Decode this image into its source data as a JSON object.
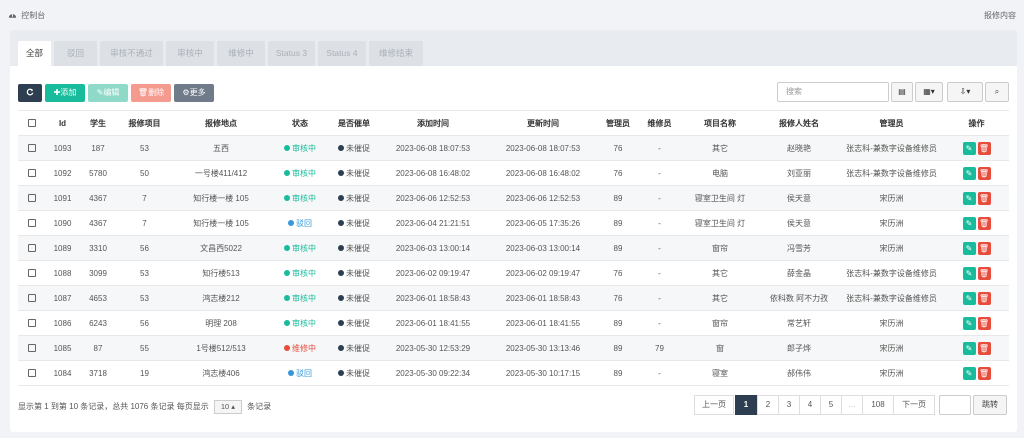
{
  "breadcrumb": "控制台",
  "page_title": "报修内容",
  "tabs": [
    {
      "label": "全部"
    },
    {
      "label": "驳回"
    },
    {
      "label": "审核不通过"
    },
    {
      "label": "审核中"
    },
    {
      "label": "维修中"
    },
    {
      "label": "Status 3"
    },
    {
      "label": "Status 4"
    },
    {
      "label": "维修结束"
    }
  ],
  "toolbar": {
    "add": "添加",
    "edit": "编辑",
    "delete": "删除",
    "more": "更多"
  },
  "search": {
    "placeholder": "搜索"
  },
  "columns": [
    "Id",
    "学生",
    "报修项目",
    "报修地点",
    "状态",
    "是否催单",
    "添加时间",
    "更新时间",
    "管理员",
    "维修员",
    "项目名称",
    "报修人姓名",
    "管理员",
    "操作"
  ],
  "status_colors": {
    "审核中": "#18bc9c",
    "驳回": "#3498db",
    "维修中": "#e74c3c",
    "未催促": "#2c3e50"
  },
  "rows": [
    {
      "id": "1093",
      "student": "187",
      "item": "53",
      "location": "五西",
      "status": "审核中",
      "urge": "未催促",
      "created": "2023-06-08 18:07:53",
      "updated": "2023-06-08 18:07:53",
      "admin": "76",
      "worker": "-",
      "project": "其它",
      "reporter": "赵晓艳",
      "admin_name": "张志科-兼数字设备维修员"
    },
    {
      "id": "1092",
      "student": "5780",
      "item": "50",
      "location": "一号楼411/412",
      "status": "审核中",
      "urge": "未催促",
      "created": "2023-06-08 16:48:02",
      "updated": "2023-06-08 16:48:02",
      "admin": "76",
      "worker": "-",
      "project": "电脑",
      "reporter": "刘亚丽",
      "admin_name": "张志科-兼数字设备维修员"
    },
    {
      "id": "1091",
      "student": "4367",
      "item": "7",
      "location": "知行楼一楼 105",
      "status": "审核中",
      "urge": "未催促",
      "created": "2023-06-06 12:52:53",
      "updated": "2023-06-06 12:52:53",
      "admin": "89",
      "worker": "-",
      "project": "寝室卫生间 灯",
      "reporter": "侯天意",
      "admin_name": "宋历洲"
    },
    {
      "id": "1090",
      "student": "4367",
      "item": "7",
      "location": "知行楼一楼 105",
      "status": "驳回",
      "urge": "未催促",
      "created": "2023-06-04 21:21:51",
      "updated": "2023-06-05 17:35:26",
      "admin": "89",
      "worker": "-",
      "project": "寝室卫生间 灯",
      "reporter": "侯天意",
      "admin_name": "宋历洲"
    },
    {
      "id": "1089",
      "student": "3310",
      "item": "56",
      "location": "文昌西5022",
      "status": "审核中",
      "urge": "未催促",
      "created": "2023-06-03 13:00:14",
      "updated": "2023-06-03 13:00:14",
      "admin": "89",
      "worker": "-",
      "project": "窗帘",
      "reporter": "冯雪芳",
      "admin_name": "宋历洲"
    },
    {
      "id": "1088",
      "student": "3099",
      "item": "53",
      "location": "知行楼513",
      "status": "审核中",
      "urge": "未催促",
      "created": "2023-06-02 09:19:47",
      "updated": "2023-06-02 09:19:47",
      "admin": "76",
      "worker": "-",
      "project": "其它",
      "reporter": "薛金晶",
      "admin_name": "张志科-兼数字设备维修员"
    },
    {
      "id": "1087",
      "student": "4653",
      "item": "53",
      "location": "鸿志楼212",
      "status": "审核中",
      "urge": "未催促",
      "created": "2023-06-01 18:58:43",
      "updated": "2023-06-01 18:58:43",
      "admin": "76",
      "worker": "-",
      "project": "其它",
      "reporter": "依科数 阿不力孜",
      "admin_name": "张志科-兼数字设备维修员"
    },
    {
      "id": "1086",
      "student": "6243",
      "item": "56",
      "location": "明理 208",
      "status": "审核中",
      "urge": "未催促",
      "created": "2023-06-01 18:41:55",
      "updated": "2023-06-01 18:41:55",
      "admin": "89",
      "worker": "-",
      "project": "窗帘",
      "reporter": "常艺轩",
      "admin_name": "宋历洲"
    },
    {
      "id": "1085",
      "student": "87",
      "item": "55",
      "location": "1号楼512/513",
      "status": "维修中",
      "urge": "未催促",
      "created": "2023-05-30 12:53:29",
      "updated": "2023-05-30 13:13:46",
      "admin": "89",
      "worker": "79",
      "project": "窗",
      "reporter": "郎子烨",
      "admin_name": "宋历洲"
    },
    {
      "id": "1084",
      "student": "3718",
      "item": "19",
      "location": "鸿志楼406",
      "status": "驳回",
      "urge": "未催促",
      "created": "2023-05-30 09:22:34",
      "updated": "2023-05-30 10:17:15",
      "admin": "89",
      "worker": "-",
      "project": "寝室",
      "reporter": "郝伟伟",
      "admin_name": "宋历洲"
    }
  ],
  "footer": {
    "info": "显示第 1 到第 10 条记录，总共 1076 条记录 每页显示",
    "page_size": "10 ▴",
    "suffix": "条记录"
  },
  "pagination": [
    "上一页",
    "1",
    "2",
    "3",
    "4",
    "5",
    "...",
    "108",
    "下一页"
  ],
  "jump": "跳转"
}
